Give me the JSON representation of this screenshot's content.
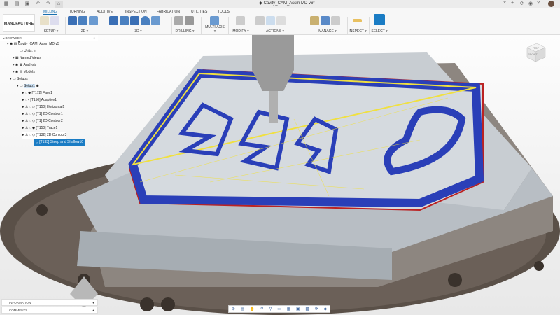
{
  "title_bar": {
    "document_title": "Cavity_CAM_Assm MD v6*",
    "quick_access": [
      "grid-icon",
      "file-icon",
      "save-icon",
      "undo-icon",
      "redo-icon",
      "home-icon"
    ],
    "right_icons": [
      "close-icon",
      "plus-icon",
      "refresh-icon",
      "clock-icon",
      "help-icon",
      "avatar"
    ]
  },
  "toolbar": {
    "workspace": "MANUFACTURE ▾",
    "tabs": [
      "MILLING",
      "TURNING",
      "ADDITIVE",
      "INSPECTION",
      "FABRICATION",
      "UTILITIES",
      "TOOLS"
    ],
    "active_tab": "MILLING",
    "groups": [
      {
        "label": "SETUP ▾"
      },
      {
        "label": "2D ▾"
      },
      {
        "label": "3D ▾"
      },
      {
        "label": "DRILLING ▾"
      },
      {
        "label": "MULTI-AXIS ▾"
      },
      {
        "label": "MODIFY ▾"
      },
      {
        "label": "ACTIONS ▾"
      },
      {
        "label": "MANAGE ▾"
      },
      {
        "label": "INSPECT ▾"
      },
      {
        "label": "SELECT ▾"
      }
    ]
  },
  "browser": {
    "header": "BROWSER",
    "items": [
      {
        "label": "Cavity_CAM_Assm MD v5"
      },
      {
        "label": "Units: in"
      },
      {
        "label": "Named Views"
      },
      {
        "label": "Analysis"
      },
      {
        "label": "Models"
      },
      {
        "label": "Setups"
      },
      {
        "label": "Setup1"
      },
      {
        "label": "[T172] Face1"
      },
      {
        "label": "[T150] Adaptive1"
      },
      {
        "label": "[T150] Horizontal1"
      },
      {
        "label": "[T1] 2D Contour1"
      },
      {
        "label": "[T1] 2D Contour2"
      },
      {
        "label": "[T150] Trace1"
      },
      {
        "label": "[T132] 2D Contour3"
      },
      {
        "label": "[T133] Steep and Shallow10"
      }
    ]
  },
  "bottom_panels": {
    "information": "INFORMATION",
    "comments": "COMMENTS"
  },
  "viewcube": {
    "top": "TOP",
    "front": "FRONT"
  },
  "navbar": {
    "icons": [
      "orbit-icon",
      "pan-icon",
      "hand-icon",
      "zoom-icon",
      "zoom-window-icon",
      "display-icon",
      "grid-icon",
      "view-icon",
      "effects-icon",
      "rotate-icon",
      "environment-icon"
    ]
  },
  "colors": {
    "accent": "#1a7cc4",
    "toolpath": "#2a3fb8",
    "rapid": "#f0e040"
  }
}
